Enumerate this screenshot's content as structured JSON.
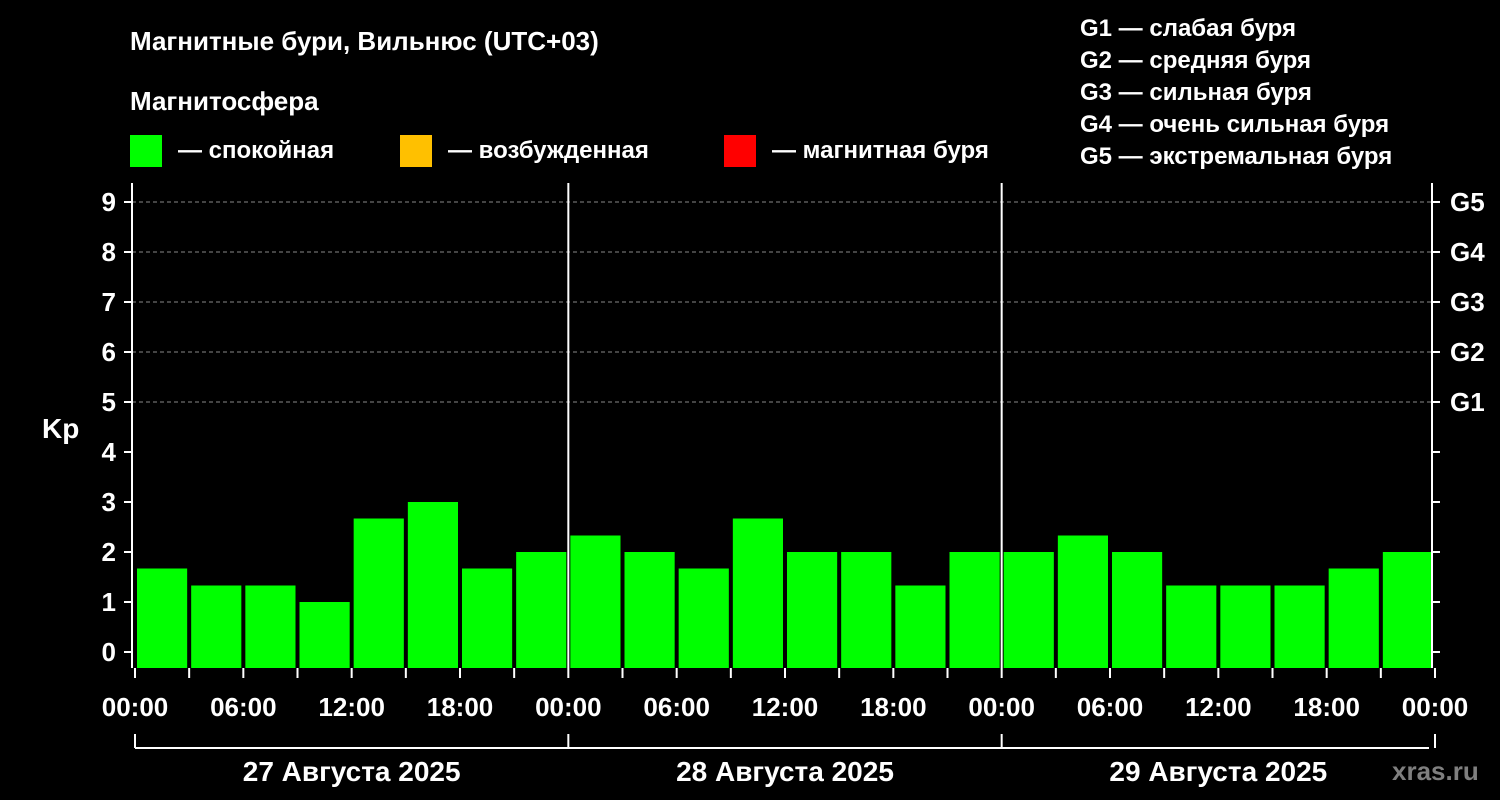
{
  "title": "Магнитные бури, Вильнюс (UTC+03)",
  "magnetosphere_title": "Магнитосфера",
  "legend": [
    {
      "label": "— спокойная",
      "color": "#00ff00"
    },
    {
      "label": "— возбужденная",
      "color": "#ffc000"
    },
    {
      "label": "— магнитная буря",
      "color": "#ff0000"
    }
  ],
  "storm_levels": [
    "G1 — слабая буря",
    "G2 — средняя буря",
    "G3 — сильная буря",
    "G4 — очень сильная буря",
    "G5 — экстремальная буря"
  ],
  "watermark": "xras.ru",
  "chart_data": {
    "type": "bar",
    "ylabel": "Kp",
    "ylim": [
      0,
      9
    ],
    "yticks": [
      "0",
      "1",
      "2",
      "3",
      "4",
      "5",
      "6",
      "7",
      "8",
      "9"
    ],
    "right_ticks": [
      {
        "value": 5,
        "label": "G1"
      },
      {
        "value": 6,
        "label": "G2"
      },
      {
        "value": 7,
        "label": "G3"
      },
      {
        "value": 8,
        "label": "G4"
      },
      {
        "value": 9,
        "label": "G5"
      }
    ],
    "grid": "dashed horizontal at Kp 5–9",
    "x_tick_labels": [
      "00:00",
      "06:00",
      "12:00",
      "18:00",
      "00:00",
      "06:00",
      "12:00",
      "18:00",
      "00:00",
      "06:00",
      "12:00",
      "18:00",
      "00:00"
    ],
    "days": [
      "27 Августа 2025",
      "28 Августа 2025",
      "29 Августа 2025"
    ],
    "interval_hours": 3,
    "values": [
      1.67,
      1.33,
      1.33,
      1.0,
      2.67,
      3.0,
      1.67,
      2.0,
      2.33,
      2.0,
      1.67,
      2.67,
      2.0,
      2.0,
      1.33,
      2.0,
      2.0,
      2.33,
      2.0,
      1.33,
      1.33,
      1.33,
      1.67,
      2.0
    ],
    "bar_color": "#00ff00"
  }
}
